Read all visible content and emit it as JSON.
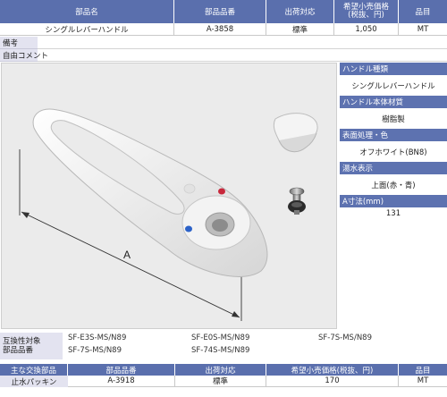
{
  "top_table": {
    "headers": {
      "part_name": "部品名",
      "part_number": "部品品番",
      "shipping": "出荷対応",
      "price_line1": "希望小売価格",
      "price_line2": "(税抜、円)",
      "origin": "品目"
    },
    "row": {
      "part_name": "シングルレバーハンドル",
      "part_number": "A-3858",
      "shipping": "標準",
      "price": "1,050",
      "origin": "MT"
    }
  },
  "info_rows": {
    "note_label": "備考",
    "comment_label": "自由コメント",
    "note_value": "",
    "comment_value": ""
  },
  "product_image": {
    "dimension_label": "A"
  },
  "specs": [
    {
      "title": "ハンドル種類",
      "value": "シングルレバーハンドル"
    },
    {
      "title": "ハンドル本体材質",
      "value": "樹脂製"
    },
    {
      "title": "表面処理・色",
      "value": "オフホワイト(BN8)"
    },
    {
      "title": "湯水表示",
      "value": "上面(赤・青)"
    },
    {
      "title": "A寸法(mm)",
      "value": "131"
    }
  ],
  "compat": {
    "label_line1": "互換性対象",
    "label_line2": "部品品番",
    "items": [
      "SF-E3S-MS/N89",
      "SF-E0S-MS/N89",
      "SF-7S-MS/N89",
      "SF-7S-MS/N89",
      "SF-74S-MS/N89"
    ]
  },
  "bottom_table": {
    "headers": {
      "main_part": "主な交換部品",
      "part_number": "部品品番",
      "shipping": "出荷対応",
      "price": "希望小売価格(税抜、円)",
      "origin": "品目"
    },
    "row": {
      "main_part": "止水パッキン",
      "part_number": "A-3918",
      "shipping": "標準",
      "price": "170",
      "origin": "MT"
    }
  },
  "colors": {
    "header_blue": "#5a6fad",
    "label_bg": "#e3e3f0",
    "hot_red": "#c8283c",
    "cold_blue": "#2c62c8"
  }
}
